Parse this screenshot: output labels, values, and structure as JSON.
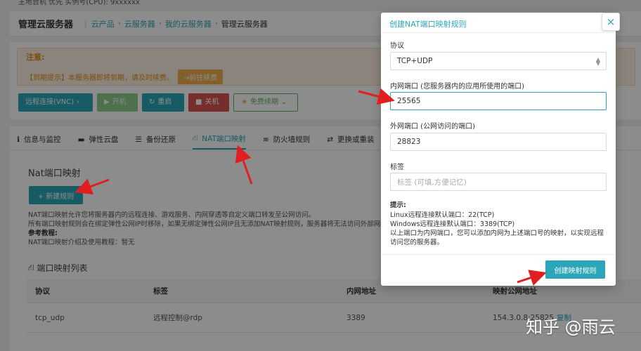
{
  "topline": "主地台机 优先 实例号(CPU): 9xxxxxx",
  "header": {
    "title": "管理云服务器",
    "crumbs": [
      "云产品",
      "云服务器",
      "我的云服务器",
      "管理云服务器"
    ]
  },
  "alert": {
    "title": "注意:",
    "message": "【到期提示】本服务器即将到期，请及时续费。",
    "renew_label": "→前往续费"
  },
  "action_buttons": {
    "vnc": "远程连接(VNC)",
    "power_on": "开机",
    "restart": "重启",
    "shutdown": "关机",
    "free_renew": "免费续期"
  },
  "tabs": [
    "信息与监控",
    "弹性云盘",
    "备份还原",
    "NAT端口映射",
    "防火墙规则",
    "更换或重装"
  ],
  "nat": {
    "title": "Nat端口映射",
    "new_rule": "+ 新建规则",
    "desc_line1": "NAT端口映射允许您将服务器内的远程连接、游戏服务、内网穿透等自定义端口转发至公网访问。",
    "desc_line2": "所有端口映射规则会在绑定弹性公网IP时移除，如果无绑定弹性公网IP且无添加NAT映射规则，服务器将无法访问外部网络",
    "ref_title": "参考教程:",
    "ref_text": "NAT端口映射介绍及使用教程：暂无"
  },
  "list": {
    "title": "端口映射列表",
    "columns": [
      "协议",
      "标签",
      "内网地址",
      "映射公网地址"
    ],
    "rows": [
      {
        "protocol": "tcp_udp",
        "label": "远程控制@rdp",
        "internal": "3389",
        "public": "154.3.0.8:25825",
        "copy": "复制"
      }
    ]
  },
  "modal": {
    "title": "创建NAT端口映射规则",
    "close_icon": "×",
    "protocol_label": "协议",
    "protocol_value": "TCP+UDP",
    "internal_label": "内网端口 (您服务器内的应用所使用的端口)",
    "internal_value": "25565",
    "external_label": "外网端口 (公网访问的端口)",
    "external_value": "28823",
    "tag_label": "标签",
    "tag_placeholder": "标签 (可填,方便记忆)",
    "tips_title": "提示:",
    "tips_line1": "Linux远程连接默认端口：22(TCP)",
    "tips_line2": "Windows远程连接默认端口：3389(TCP)",
    "tips_line3": "以上端口为内网端口，您可以添加内网为上述端口号的映射，以实现远程访问您的服务器。",
    "submit": "创建映射规则"
  },
  "watermark": "知乎 @雨云",
  "colors": {
    "accent": "#2ba6b8",
    "danger": "#d9534f",
    "success": "#5cb85c",
    "warning": "#f0ad4e",
    "annotation_arrow": "#e02020"
  }
}
